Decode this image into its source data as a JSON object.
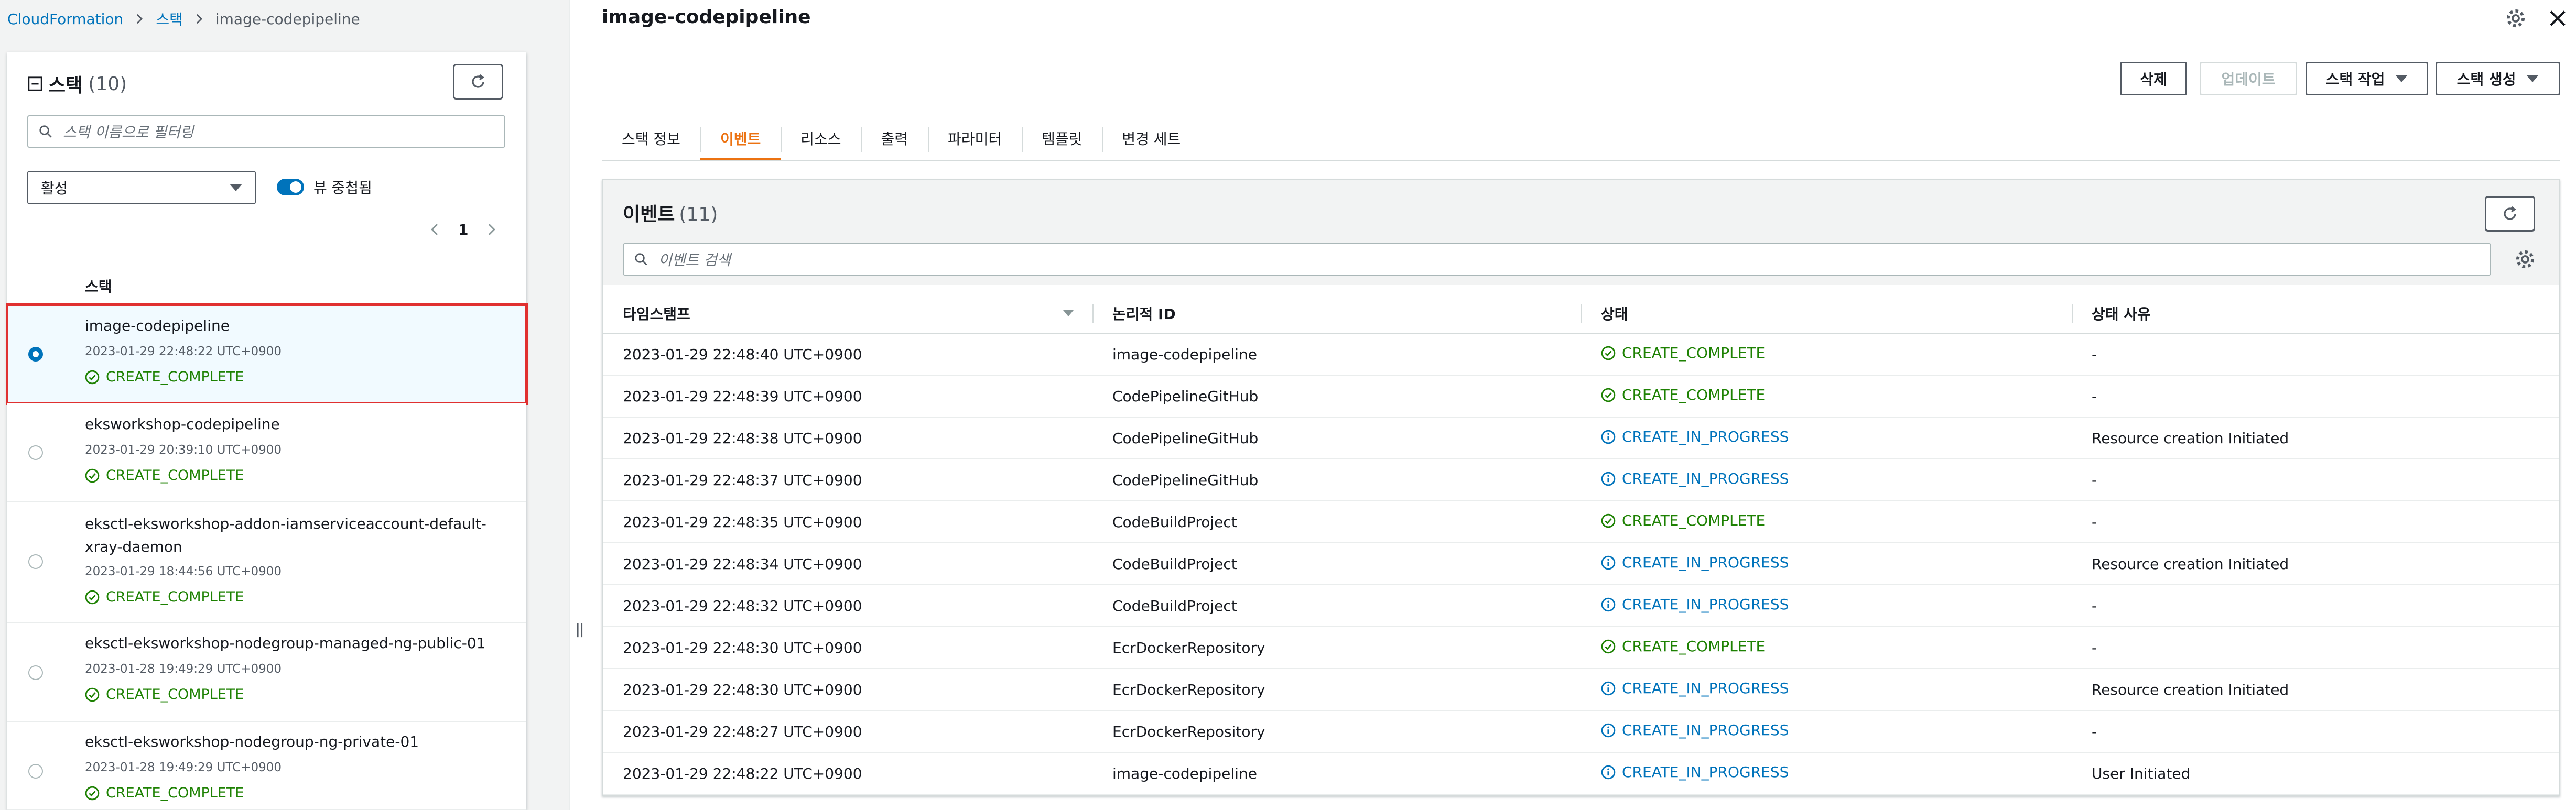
{
  "breadcrumb": {
    "root": "CloudFormation",
    "section": "스택",
    "current": "image-codepipeline"
  },
  "sidebar": {
    "title": "스택",
    "count": "(10)",
    "search_placeholder": "스택 이름으로 필터링",
    "filter_value": "활성",
    "nested_toggle_label": "뷰 중첩됨",
    "page": "1",
    "column_header": "스택",
    "stacks": [
      {
        "name": "image-codepipeline",
        "time": "2023-01-29 22:48:22 UTC+0900",
        "status": "CREATE_COMPLETE",
        "selected": true
      },
      {
        "name": "eksworkshop-codepipeline",
        "time": "2023-01-29 20:39:10 UTC+0900",
        "status": "CREATE_COMPLETE",
        "selected": false
      },
      {
        "name": "eksctl-eksworkshop-addon-iamserviceaccount-default-xray-daemon",
        "time": "2023-01-29 18:44:56 UTC+0900",
        "status": "CREATE_COMPLETE",
        "selected": false
      },
      {
        "name": "eksctl-eksworkshop-nodegroup-managed-ng-public-01",
        "time": "2023-01-28 19:49:29 UTC+0900",
        "status": "CREATE_COMPLETE",
        "selected": false
      },
      {
        "name": "eksctl-eksworkshop-nodegroup-ng-private-01",
        "time": "2023-01-28 19:49:29 UTC+0900",
        "status": "CREATE_COMPLETE",
        "selected": false
      }
    ]
  },
  "main": {
    "title": "image-codepipeline",
    "actions": {
      "delete": "삭제",
      "update": "업데이트",
      "stack_actions": "스택 작업",
      "create_stack": "스택 생성"
    },
    "tabs": [
      "스택 정보",
      "이벤트",
      "리소스",
      "출력",
      "파라미터",
      "템플릿",
      "변경 세트"
    ],
    "active_tab": "이벤트",
    "events": {
      "title": "이벤트",
      "count": "(11)",
      "search_placeholder": "이벤트 검색",
      "columns": [
        "타임스탬프",
        "논리적 ID",
        "상태",
        "상태 사유"
      ],
      "rows": [
        {
          "timestamp": "2023-01-29 22:48:40 UTC+0900",
          "logical_id": "image-codepipeline",
          "status": "CREATE_COMPLETE",
          "reason": "-"
        },
        {
          "timestamp": "2023-01-29 22:48:39 UTC+0900",
          "logical_id": "CodePipelineGitHub",
          "status": "CREATE_COMPLETE",
          "reason": "-"
        },
        {
          "timestamp": "2023-01-29 22:48:38 UTC+0900",
          "logical_id": "CodePipelineGitHub",
          "status": "CREATE_IN_PROGRESS",
          "reason": "Resource creation Initiated"
        },
        {
          "timestamp": "2023-01-29 22:48:37 UTC+0900",
          "logical_id": "CodePipelineGitHub",
          "status": "CREATE_IN_PROGRESS",
          "reason": "-"
        },
        {
          "timestamp": "2023-01-29 22:48:35 UTC+0900",
          "logical_id": "CodeBuildProject",
          "status": "CREATE_COMPLETE",
          "reason": "-"
        },
        {
          "timestamp": "2023-01-29 22:48:34 UTC+0900",
          "logical_id": "CodeBuildProject",
          "status": "CREATE_IN_PROGRESS",
          "reason": "Resource creation Initiated"
        },
        {
          "timestamp": "2023-01-29 22:48:32 UTC+0900",
          "logical_id": "CodeBuildProject",
          "status": "CREATE_IN_PROGRESS",
          "reason": "-"
        },
        {
          "timestamp": "2023-01-29 22:48:30 UTC+0900",
          "logical_id": "EcrDockerRepository",
          "status": "CREATE_COMPLETE",
          "reason": "-"
        },
        {
          "timestamp": "2023-01-29 22:48:30 UTC+0900",
          "logical_id": "EcrDockerRepository",
          "status": "CREATE_IN_PROGRESS",
          "reason": "Resource creation Initiated"
        },
        {
          "timestamp": "2023-01-29 22:48:27 UTC+0900",
          "logical_id": "EcrDockerRepository",
          "status": "CREATE_IN_PROGRESS",
          "reason": "-"
        },
        {
          "timestamp": "2023-01-29 22:48:22 UTC+0900",
          "logical_id": "image-codepipeline",
          "status": "CREATE_IN_PROGRESS",
          "reason": "User Initiated"
        }
      ]
    }
  },
  "colors": {
    "link": "#0073bb",
    "success": "#1d8102",
    "in_progress": "#0073bb",
    "active_tab": "#ec7211",
    "selection_outline": "#e03030"
  },
  "icons": {
    "refresh": "refresh-icon",
    "search": "search-icon",
    "settings": "gear-icon",
    "close": "close-icon",
    "complete": "check-circle-icon",
    "in_progress": "info-circle-icon"
  }
}
